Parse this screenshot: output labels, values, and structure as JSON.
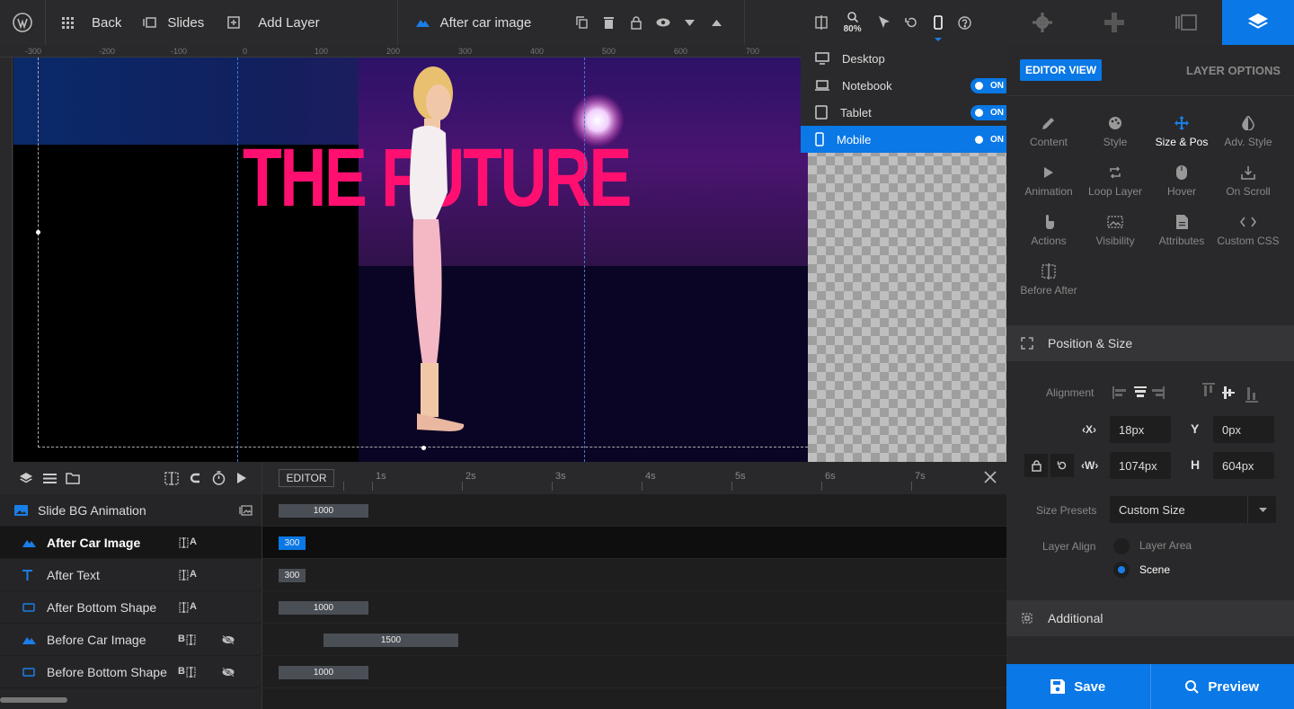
{
  "topbar": {
    "back_label": "Back",
    "slides_label": "Slides",
    "add_layer_label": "Add Layer",
    "current_layer_name": "After car image",
    "zoom_label": "80%"
  },
  "ruler": {
    "marks": [
      "-300",
      "-200",
      "-100",
      "0",
      "100",
      "200",
      "300",
      "400",
      "500",
      "600",
      "700"
    ]
  },
  "canvas": {
    "headline_text": "THE FUTURE"
  },
  "device_menu": {
    "items": [
      {
        "label": "Desktop",
        "toggle": ""
      },
      {
        "label": "Notebook",
        "toggle": "ON"
      },
      {
        "label": "Tablet",
        "toggle": "ON"
      },
      {
        "label": "Mobile",
        "toggle": "ON"
      }
    ]
  },
  "panel": {
    "editor_view_label": "EDITOR VIEW",
    "layer_options_label": "LAYER OPTIONS",
    "options": [
      {
        "label": "Content",
        "icon": "pencil-icon"
      },
      {
        "label": "Style",
        "icon": "palette-icon"
      },
      {
        "label": "Size & Pos",
        "icon": "move-icon"
      },
      {
        "label": "Adv. Style",
        "icon": "contrast-icon"
      },
      {
        "label": "Animation",
        "icon": "play-icon"
      },
      {
        "label": "Loop Layer",
        "icon": "loop-icon"
      },
      {
        "label": "Hover",
        "icon": "mouse-icon"
      },
      {
        "label": "On Scroll",
        "icon": "download-icon"
      },
      {
        "label": "Actions",
        "icon": "hand-icon"
      },
      {
        "label": "Visibility",
        "icon": "image-icon"
      },
      {
        "label": "Attributes",
        "icon": "document-icon"
      },
      {
        "label": "Custom CSS",
        "icon": "code-icon"
      },
      {
        "label": "Before After",
        "icon": "compare-icon"
      }
    ],
    "position_size_title": "Position & Size",
    "alignment_label": "Alignment",
    "x_label": "X",
    "x_value": "18px",
    "y_label": "Y",
    "y_value": "0px",
    "w_label": "W",
    "w_value": "1074px",
    "h_label": "H",
    "h_value": "604px",
    "size_presets_label": "Size Presets",
    "size_presets_value": "Custom Size",
    "layer_align_label": "Layer Align",
    "layer_align_options": [
      "Layer Area",
      "Scene"
    ],
    "additional_title": "Additional"
  },
  "footer": {
    "save_label": "Save",
    "preview_label": "Preview"
  },
  "timeline": {
    "editor_tag": "EDITOR",
    "ticks": [
      "1s",
      "2s",
      "3s",
      "4s",
      "5s",
      "6s",
      "7s"
    ],
    "rows": [
      {
        "label": "Slide BG Animation",
        "icon": "image-icon",
        "ctrl": "",
        "hidden": false,
        "duration": "1000"
      },
      {
        "label": "After Car Image",
        "icon": "mountain-icon",
        "ctrl": "A",
        "hidden": false,
        "duration": "300"
      },
      {
        "label": "After Text",
        "icon": "text-icon",
        "ctrl": "A",
        "hidden": false,
        "duration": "300"
      },
      {
        "label": "After Bottom Shape",
        "icon": "rectangle-icon",
        "ctrl": "A",
        "hidden": false,
        "duration": "1000"
      },
      {
        "label": "Before Car Image",
        "icon": "mountain-icon",
        "ctrl": "B",
        "hidden": true,
        "duration": "1500"
      },
      {
        "label": "Before Bottom Shape",
        "icon": "rectangle-icon",
        "ctrl": "B",
        "hidden": true,
        "duration": "1000"
      }
    ]
  }
}
